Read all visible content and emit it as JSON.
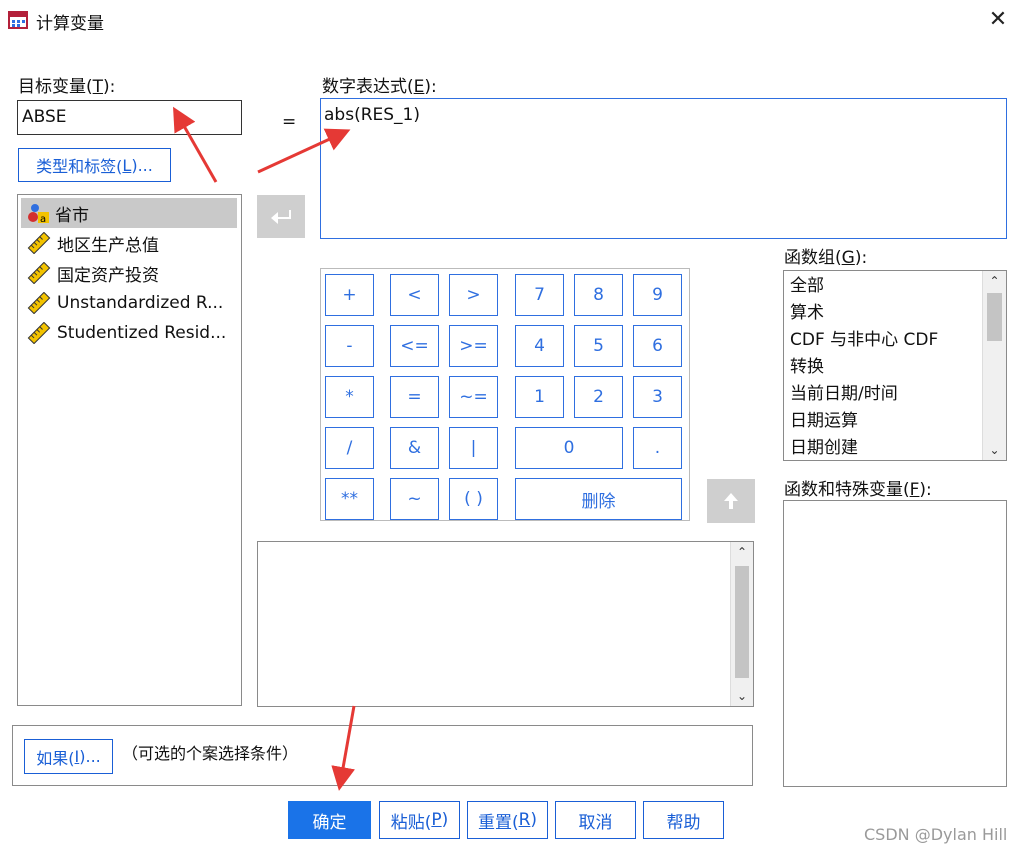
{
  "window": {
    "title": "计算变量",
    "close_glyph": "✕"
  },
  "target": {
    "label": "目标变量(",
    "label_key": "T",
    "label_end": "):",
    "value": "ABSE"
  },
  "equals": "=",
  "type_label_button": {
    "pre": "类型和标签(",
    "key": "L",
    "post": ")..."
  },
  "variables": [
    {
      "label": "省市",
      "icon": "nominal-string-icon"
    },
    {
      "label": "地区生产总值",
      "icon": "scale-ruler-icon"
    },
    {
      "label": "国定资产投资",
      "icon": "scale-ruler-icon"
    },
    {
      "label": "Unstandardized R...",
      "icon": "scale-ruler-icon"
    },
    {
      "label": "Studentized Resid...",
      "icon": "scale-ruler-icon"
    }
  ],
  "expression": {
    "label": "数字表达式(",
    "label_key": "E",
    "label_end": "):",
    "value": "abs(RES_1)"
  },
  "keypad": {
    "ops": [
      [
        "+",
        "<",
        ">"
      ],
      [
        "-",
        "<=",
        ">="
      ],
      [
        "*",
        "=",
        "~="
      ],
      [
        "/",
        "&",
        "|"
      ],
      [
        "**",
        "~",
        "( )"
      ]
    ],
    "digits": [
      [
        "7",
        "8",
        "9"
      ],
      [
        "4",
        "5",
        "6"
      ],
      [
        "1",
        "2",
        "3"
      ]
    ],
    "zero": "0",
    "dot": ".",
    "delete": "删除"
  },
  "function_group": {
    "label": "函数组(",
    "label_key": "G",
    "label_end": "):",
    "items": [
      "全部",
      "算术",
      "CDF 与非中心 CDF",
      "转换",
      "当前日期/时间",
      "日期运算",
      "日期创建"
    ]
  },
  "functions": {
    "label": "函数和特殊变量(",
    "label_key": "F",
    "label_end": "):"
  },
  "if_button": {
    "pre": "如果(",
    "key": "I",
    "post": ")..."
  },
  "if_hint": "（可选的个案选择条件）",
  "buttons": {
    "ok": "确定",
    "paste": {
      "pre": "粘贴(",
      "key": "P",
      "post": ")"
    },
    "reset": {
      "pre": "重置(",
      "key": "R",
      "post": ")"
    },
    "cancel": "取消",
    "help": "帮助"
  },
  "watermark": "CSDN @Dylan Hill",
  "colors": {
    "accent": "#1a5fd6",
    "primary": "#1a73e8",
    "annotation_arrow": "#e53935",
    "selection": "#c9c9c9"
  }
}
